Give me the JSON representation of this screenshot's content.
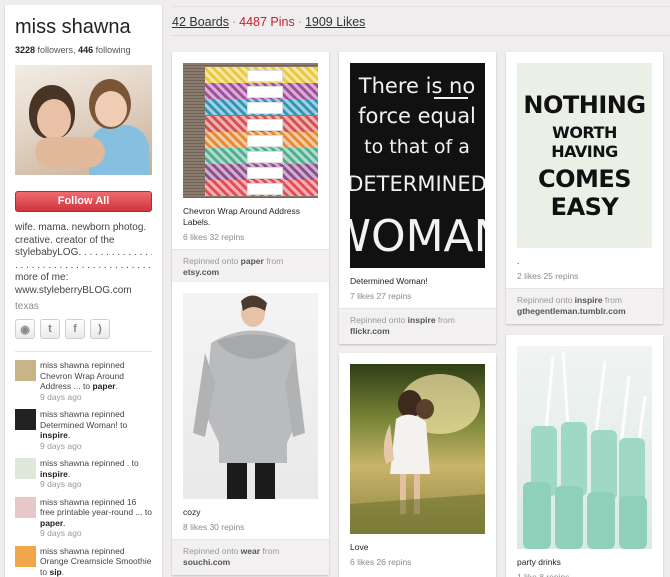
{
  "profile": {
    "name": "miss shawna",
    "followers_count": "3228",
    "followers_label": "followers,",
    "following_count": "446",
    "following_label": "following",
    "follow_all_label": "Follow All",
    "bio_lines": [
      "wife. mama. newborn photog.",
      "creative. creator of the",
      "stylebabyLOG. . . . . . . . . . . . . . .",
      ". . . . . . . . . . . . . . . . . . . . . . . . . .",
      "more of me:",
      "www.styleberryBLOG.com"
    ],
    "location": "texas",
    "social_icons": [
      "website-icon",
      "twitter-icon",
      "facebook-icon",
      "rss-icon"
    ]
  },
  "activity": [
    {
      "text": "miss shawna repinned Chevron Wrap Around Address ... to",
      "board": "paper",
      "time": "9 days ago",
      "thumb_color": "#c9b48a"
    },
    {
      "text": "miss shawna repinned Determined Woman! to",
      "board": "inspire",
      "time": "9 days ago",
      "thumb_color": "#222222"
    },
    {
      "text": "miss shawna repinned . to",
      "board": "inspire",
      "time": "9 days ago",
      "thumb_color": "#dfe8d8"
    },
    {
      "text": "miss shawna repinned 16 free printable year-round ... to",
      "board": "paper",
      "time": "9 days ago",
      "thumb_color": "#e7c7c7"
    },
    {
      "text": "miss shawna repinned Orange Creamsicle Smoothie to",
      "board": "sip",
      "time": "9 days ago",
      "thumb_color": "#f0a64a"
    }
  ],
  "header": {
    "boards": "42 Boards",
    "pins": "4487 Pins",
    "likes": "1909 Likes",
    "separator": "·"
  },
  "pins": [
    {
      "desc": "Chevron Wrap Around Address Labels.",
      "counts": "6 likes  32 repins",
      "repinned_prefix": "Repinned onto",
      "board": "paper",
      "from": "from",
      "source": "etsy.com"
    },
    {
      "desc": "Determined Woman!",
      "counts": "7 likes  27 repins",
      "repinned_prefix": "Repinned onto",
      "board": "inspire",
      "from": "from",
      "source": "flickr.com"
    },
    {
      "desc": ".",
      "counts": "2 likes  25 repins",
      "repinned_prefix": "Repinned onto",
      "board": "inspire",
      "from": "from",
      "source": "gthegentleman.tumblr.com"
    },
    {
      "desc": "cozy",
      "counts": "8 likes  30 repins",
      "repinned_prefix": "Repinned onto",
      "board": "wear",
      "from": "from",
      "source": "souchi.com"
    },
    {
      "desc": "Love",
      "counts": "6 likes  26 repins"
    },
    {
      "desc": "party drinks",
      "counts": "1 like  8 repins"
    }
  ],
  "chalk_lines": [
    "There is no",
    "force equal",
    "to that of a",
    "DETERMINED",
    "WOMAN"
  ],
  "type_card_lines": [
    "NOTHING",
    "WORTH HAVING",
    "COMES EASY"
  ],
  "label_colors": [
    "#e9c83a",
    "#a34b9c",
    "#2e95b7",
    "#d3504e",
    "#e58a33",
    "#4dae8d",
    "#8d4d8c",
    "#e24c56"
  ]
}
